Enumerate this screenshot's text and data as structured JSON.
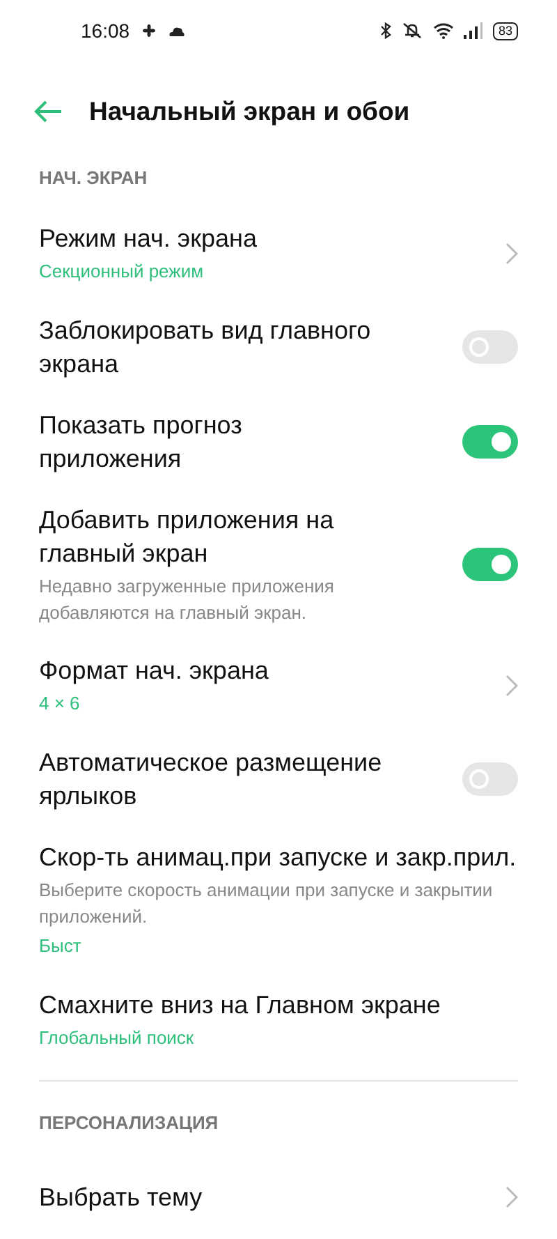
{
  "status_bar": {
    "time": "16:08",
    "battery": "83"
  },
  "header": {
    "title": "Начальный экран и обои"
  },
  "sections": [
    {
      "label": "НАЧ. ЭКРАН",
      "items": [
        {
          "kind": "nav",
          "title": "Режим нач. экрана",
          "value": "Секционный режим"
        },
        {
          "kind": "toggle",
          "title": "Заблокировать вид главного экрана",
          "on": false
        },
        {
          "kind": "toggle",
          "title": "Показать прогноз приложения",
          "on": true
        },
        {
          "kind": "toggle",
          "title": "Добавить приложения на главный экран",
          "subtitle": "Недавно загруженные приложения добавляются на главный экран.",
          "on": true
        },
        {
          "kind": "nav",
          "title": "Формат нач. экрана",
          "value": "4 × 6"
        },
        {
          "kind": "toggle",
          "title": "Автоматическое размещение ярлыков",
          "on": false
        },
        {
          "kind": "info",
          "title": "Скор-ть анимац.при запуске и закр.прил.",
          "subtitle": "Выберите скорость анимации при запуске и закрытии приложений.",
          "value": "Быст"
        },
        {
          "kind": "info",
          "title": "Смахните вниз на Главном экране",
          "value": "Глобальный поиск"
        }
      ]
    },
    {
      "label": "ПЕРСОНАЛИЗАЦИЯ",
      "items": [
        {
          "kind": "nav",
          "title": "Выбрать тему"
        }
      ]
    }
  ]
}
